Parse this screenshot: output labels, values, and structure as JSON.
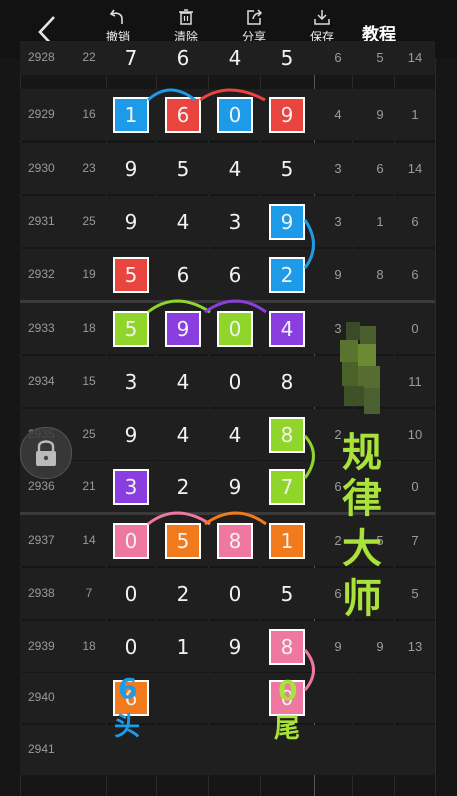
{
  "toolbar": {
    "undo_label": "撤销",
    "clear_label": "清除",
    "share_label": "分享",
    "save_label": "保存",
    "tutorial_label": "教程"
  },
  "colors": {
    "blue": "#1e9be8",
    "red": "#e9443d",
    "lime": "#8fd52a",
    "purple": "#8a3ee0",
    "pink": "#ee78a0",
    "orange": "#f07a1c",
    "watermark": "#a8e23a"
  },
  "rows": [
    {
      "period": "2928",
      "sum": "22",
      "digits": [
        "7",
        "6",
        "4",
        "5"
      ],
      "stats": [
        "6",
        "5",
        "14"
      ]
    },
    {
      "period": "2929",
      "sum": "16",
      "digits": [
        "1",
        "6",
        "0",
        "9"
      ],
      "stats": [
        "4",
        "9",
        "1"
      ]
    },
    {
      "period": "2930",
      "sum": "23",
      "digits": [
        "9",
        "5",
        "4",
        "5"
      ],
      "stats": [
        "3",
        "6",
        "14"
      ]
    },
    {
      "period": "2931",
      "sum": "25",
      "digits": [
        "9",
        "4",
        "3",
        "9"
      ],
      "stats": [
        "3",
        "1",
        "6"
      ]
    },
    {
      "period": "2932",
      "sum": "19",
      "digits": [
        "5",
        "6",
        "6",
        "2"
      ],
      "stats": [
        "9",
        "8",
        "6"
      ]
    },
    {
      "period": "2933",
      "sum": "18",
      "digits": [
        "5",
        "9",
        "0",
        "4"
      ],
      "stats": [
        "3",
        "",
        "0"
      ]
    },
    {
      "period": "2934",
      "sum": "15",
      "digits": [
        "3",
        "4",
        "0",
        "8"
      ],
      "stats": [
        "",
        "",
        "11"
      ]
    },
    {
      "period": "2935",
      "sum": "25",
      "digits": [
        "9",
        "4",
        "4",
        "8"
      ],
      "stats": [
        "2",
        "",
        "10"
      ]
    },
    {
      "period": "2936",
      "sum": "21",
      "digits": [
        "3",
        "2",
        "9",
        "7"
      ],
      "stats": [
        "6",
        "",
        "0"
      ]
    },
    {
      "period": "2937",
      "sum": "14",
      "digits": [
        "0",
        "5",
        "8",
        "1"
      ],
      "stats": [
        "2",
        "5",
        "7"
      ]
    },
    {
      "period": "2938",
      "sum": "7",
      "digits": [
        "0",
        "2",
        "0",
        "5"
      ],
      "stats": [
        "6",
        "",
        "5"
      ]
    },
    {
      "period": "2939",
      "sum": "18",
      "digits": [
        "0",
        "1",
        "9",
        "8"
      ],
      "stats": [
        "9",
        "9",
        "13"
      ]
    },
    {
      "period": "2940",
      "sum": "",
      "digits": [
        "6",
        "",
        "",
        "0"
      ],
      "stats": [
        "",
        "",
        ""
      ]
    },
    {
      "period": "2941",
      "sum": "",
      "digits": [
        "",
        "",
        "",
        ""
      ],
      "stats": [
        "",
        "",
        ""
      ]
    }
  ],
  "annotations": {
    "head_digit": "6",
    "head_label": "头",
    "tail_digit": "0",
    "tail_label": "尾"
  },
  "watermark": [
    "规",
    "律",
    "大",
    "师"
  ]
}
